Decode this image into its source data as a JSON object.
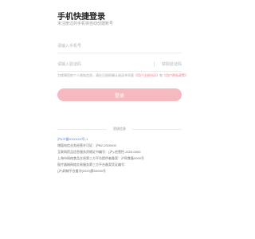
{
  "login": {
    "title": "手机快捷登录",
    "subtitle": "未注册过的手机将自动创建账号",
    "phone_placeholder": "请输入手机号",
    "code_placeholder": "请输入验证码",
    "get_code_label": "获取验证码",
    "agreement_prefix": "为保障您的个人隐私信息，请在注册前确认阅读并同意",
    "user_agreement": "《用户注册协议》",
    "and_text": "和",
    "privacy_policy": "《用户隐私政策》",
    "login_button": "登录"
  },
  "footer": {
    "divider_text": "资质信息",
    "icp_link": "沪ICP备XXXXXX号-1",
    "lines": [
      "增值电信业务经营许可证：沪B2-2020000",
      "互联网药品信息服务资格证书编号：(沪)-经营性-2020-0000",
      "上海市网络食品交易第三方平台提供者备案：沪网食备0000号",
      "医疗器械网络交易服务第三方平台备案凭证编号：",
      "(沪)网械平台备字[2020]第00000号"
    ]
  }
}
